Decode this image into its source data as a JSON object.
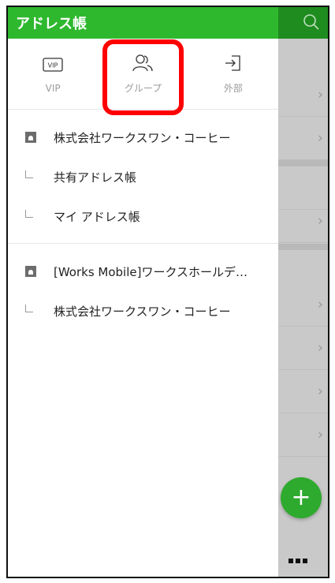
{
  "header": {
    "title": "アドレス帳"
  },
  "tabs": [
    {
      "label": "VIP",
      "icon": "vip-icon"
    },
    {
      "label": "グループ",
      "icon": "group-icon"
    },
    {
      "label": "外部",
      "icon": "external-icon"
    }
  ],
  "company1": {
    "name": "株式会社ワークスワン・コーヒー",
    "children": [
      "共有アドレス帳",
      "マイ アドレス帳"
    ]
  },
  "company2": {
    "name": "[Works Mobile]ワークスホールデ…",
    "children": [
      "株式会社ワークスワン・コーヒー"
    ]
  },
  "colors": {
    "header_green": "#2eb82e",
    "highlight_red": "#ff0000",
    "fab_green": "#2eaa2e"
  }
}
